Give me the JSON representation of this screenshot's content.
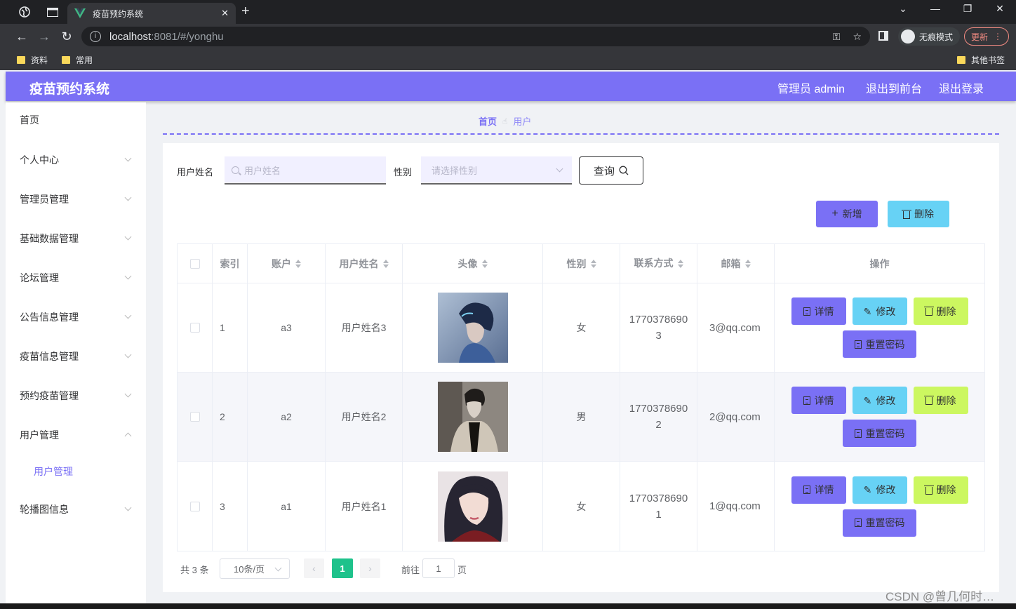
{
  "browser": {
    "tab_title": "疫苗预约系统",
    "url_host": "localhost",
    "url_rest": ":8081/#/yonghu",
    "incognito_label": "无痕模式",
    "update_label": "更新",
    "bookmarks": [
      "资料",
      "常用"
    ],
    "other_bookmarks": "其他书签"
  },
  "header": {
    "title": "疫苗预约系统",
    "admin_label": "管理员 admin",
    "front_label": "退出到前台",
    "logout_label": "退出登录"
  },
  "sidebar": {
    "items": [
      {
        "label": "首页"
      },
      {
        "label": "个人中心"
      },
      {
        "label": "管理员管理"
      },
      {
        "label": "基础数据管理"
      },
      {
        "label": "论坛管理"
      },
      {
        "label": "公告信息管理"
      },
      {
        "label": "疫苗信息管理"
      },
      {
        "label": "预约疫苗管理"
      },
      {
        "label": "用户管理"
      },
      {
        "label": "轮播图信息"
      }
    ],
    "sub_item": "用户管理"
  },
  "breadcrumb": {
    "home": "首页",
    "current": "用户"
  },
  "filters": {
    "name_label": "用户姓名",
    "name_placeholder": "用户姓名",
    "gender_label": "性别",
    "gender_placeholder": "请选择性别",
    "query_label": "查询"
  },
  "actions": {
    "add_label": "新增",
    "delete_label": "删除"
  },
  "table": {
    "headers": [
      "索引",
      "账户",
      "用户姓名",
      "头像",
      "性别",
      "联系方式",
      "邮箱",
      "操作"
    ],
    "rows": [
      {
        "index": "1",
        "account": "a3",
        "name": "用户姓名3",
        "gender": "女",
        "phone": "17703786903",
        "email": "3@qq.com"
      },
      {
        "index": "2",
        "account": "a2",
        "name": "用户姓名2",
        "gender": "男",
        "phone": "17703786902",
        "email": "2@qq.com"
      },
      {
        "index": "3",
        "account": "a1",
        "name": "用户姓名1",
        "gender": "女",
        "phone": "17703786901",
        "email": "1@qq.com"
      }
    ],
    "op_labels": {
      "detail": "详情",
      "edit": "修改",
      "delete": "删除",
      "reset": "重置密码"
    }
  },
  "pagination": {
    "total": "共 3 条",
    "page_size": "10条/页",
    "current_page": "1",
    "goto_prefix": "前往",
    "goto_value": "1",
    "goto_suffix": "页"
  },
  "watermark": "CSDN @曾几何时…",
  "colors": {
    "primary": "#7a70f5",
    "info": "#67d2f5",
    "lime": "#ccf760",
    "page_active": "#1ec28b"
  }
}
